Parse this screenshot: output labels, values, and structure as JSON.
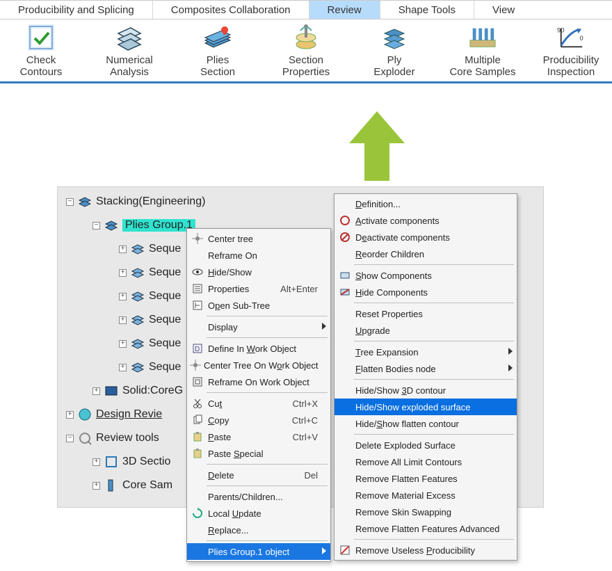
{
  "tabs": {
    "items": [
      {
        "label": "Producibility and Splicing",
        "active": false
      },
      {
        "label": "Composites Collaboration",
        "active": false
      },
      {
        "label": "Review",
        "active": true
      },
      {
        "label": "Shape Tools",
        "active": false
      },
      {
        "label": "View",
        "active": false
      }
    ]
  },
  "ribbon": {
    "buttons": [
      {
        "name": "check-contours",
        "line1": "Check",
        "line2": "Contours"
      },
      {
        "name": "numerical-analysis",
        "line1": "Numerical",
        "line2": "Analysis"
      },
      {
        "name": "plies-section",
        "line1": "Plies",
        "line2": "Section"
      },
      {
        "name": "section-properties",
        "line1": "Section",
        "line2": "Properties"
      },
      {
        "name": "ply-exploder",
        "line1": "Ply",
        "line2": "Exploder"
      },
      {
        "name": "multiple-core-samples",
        "line1": "Multiple",
        "line2": "Core Samples"
      },
      {
        "name": "producibility-inspection",
        "line1": "Producibility",
        "line2": "Inspection"
      }
    ]
  },
  "tree": {
    "root": "Stacking(Engineering)",
    "plies_group": "Plies Group.1",
    "seq_prefix": "Seque",
    "solid_core": "Solid:CoreG",
    "design_review": "Design Revie",
    "review_tools": "Review tools",
    "threed_section": "3D Sectio",
    "core_sample": "Core Sam"
  },
  "menu1": {
    "items": [
      {
        "label": "Center tree",
        "icon": "center-tree-icon"
      },
      {
        "label": "Reframe On",
        "mn": "Reframe On"
      },
      {
        "label": "Hide/Show",
        "icon": "eye-icon",
        "u": 0
      },
      {
        "label": "Properties",
        "icon": "properties-icon",
        "shortcut": "Alt+Enter"
      },
      {
        "label": "Open Sub-Tree",
        "icon": "subtree-icon",
        "u": 1
      },
      {
        "sep": true
      },
      {
        "label": "Display",
        "submenu": true
      },
      {
        "sep": true
      },
      {
        "label": "Define In Work Object",
        "icon": "define-icon",
        "u": 10
      },
      {
        "label": "Center Tree On Work Object",
        "icon": "center-tree-icon",
        "u": 16
      },
      {
        "label": "Reframe On Work Object",
        "icon": "reframe-icon"
      },
      {
        "sep": true
      },
      {
        "label": "Cut",
        "icon": "cut-icon",
        "shortcut": "Ctrl+X",
        "u": 2
      },
      {
        "label": "Copy",
        "icon": "copy-icon",
        "shortcut": "Ctrl+C",
        "u": 0
      },
      {
        "label": "Paste",
        "icon": "paste-icon",
        "shortcut": "Ctrl+V",
        "u": 0
      },
      {
        "label": "Paste Special",
        "icon": "paste-icon",
        "u": 6
      },
      {
        "sep": true
      },
      {
        "label": "Delete",
        "shortcut": "Del",
        "u": 0
      },
      {
        "sep": true
      },
      {
        "label": "Parents/Children..."
      },
      {
        "label": "Local Update",
        "icon": "update-icon",
        "u": 6
      },
      {
        "label": "Replace...",
        "u": 0
      },
      {
        "sep": true
      },
      {
        "label": "Plies Group.1 object",
        "submenu": true,
        "highlight": true
      }
    ]
  },
  "menu2": {
    "items": [
      {
        "label": "Definition...",
        "u": 0
      },
      {
        "label": "Activate components",
        "icon": "activate-icon",
        "u": 0
      },
      {
        "label": "Deactivate components",
        "icon": "deactivate-icon",
        "u": 1
      },
      {
        "label": "Reorder Children",
        "u": 0
      },
      {
        "sep": true
      },
      {
        "label": "Show Components",
        "icon": "show-comp-icon",
        "u": 0
      },
      {
        "label": "Hide Components",
        "icon": "hide-comp-icon",
        "u": 0
      },
      {
        "sep": true
      },
      {
        "label": "Reset Properties"
      },
      {
        "label": "Upgrade",
        "u": 0
      },
      {
        "sep": true
      },
      {
        "label": "Tree Expansion",
        "submenu": true,
        "u": 0
      },
      {
        "label": "Flatten Bodies node",
        "submenu": true,
        "u": 0
      },
      {
        "sep": true
      },
      {
        "label": "Hide/Show 3D contour",
        "u": 10
      },
      {
        "label": "Hide/Show exploded surface",
        "selected": true
      },
      {
        "label": "Hide/Show flatten contour",
        "u": 5
      },
      {
        "sep": true
      },
      {
        "label": "Delete Exploded Surface"
      },
      {
        "label": "Remove All Limit Contours"
      },
      {
        "label": "Remove Flatten Features"
      },
      {
        "label": "Remove Material Excess"
      },
      {
        "label": "Remove Skin Swapping"
      },
      {
        "label": "Remove Flatten Features Advanced"
      },
      {
        "sep": true
      },
      {
        "label": "Remove Useless Producibility",
        "icon": "remove-useless-icon",
        "u": 15
      }
    ]
  }
}
